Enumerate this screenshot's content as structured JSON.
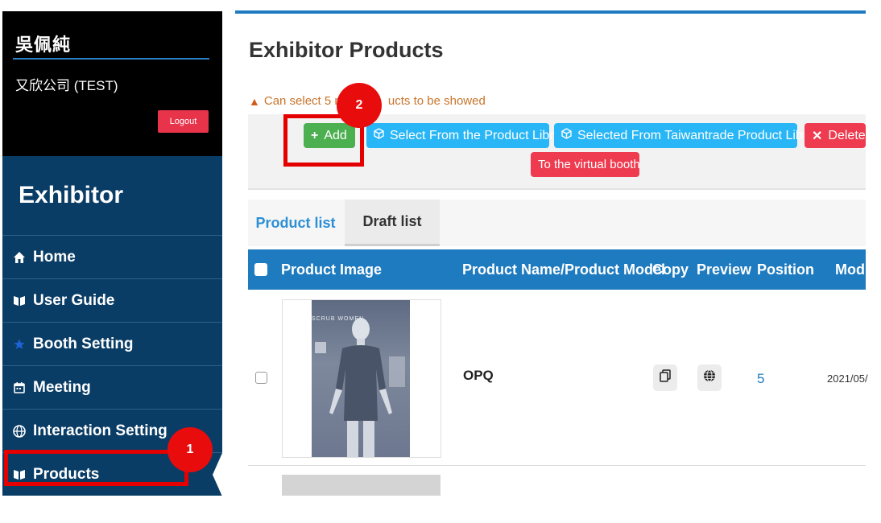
{
  "user": {
    "name": "吳佩純",
    "company": "又欣公司 (TEST)",
    "logout_label": "Logout"
  },
  "sidebar": {
    "section_title": "Exhibitor",
    "items": [
      {
        "label": "Home",
        "icon": "home-icon"
      },
      {
        "label": "User Guide",
        "icon": "book-icon"
      },
      {
        "label": "Booth Setting",
        "icon": "star-icon"
      },
      {
        "label": "Meeting",
        "icon": "calendar-icon"
      },
      {
        "label": "Interaction Setting",
        "icon": "globe-icon"
      },
      {
        "label": "Products",
        "icon": "book-icon",
        "active": true
      }
    ]
  },
  "main": {
    "title": "Exhibitor Products",
    "notice_prefix": "Can select 5 m",
    "notice_suffix": "ucts to be showed",
    "toolbar": {
      "add": "Add",
      "select_library": "Select From the Product Library",
      "select_taiwantrade": "Selected From Taiwantrade Product Library",
      "delete": "Delete",
      "virtual_booth": "To the virtual booth"
    },
    "tabs": [
      "Product list",
      "Draft list"
    ],
    "columns": {
      "image": "Product Image",
      "name": "Product Name/Product Model",
      "copy": "Copy",
      "preview": "Preview",
      "position": "Position",
      "modified": "Modif"
    },
    "rows": [
      {
        "name": "OPQ",
        "position": "5",
        "modified": "2021/05/",
        "image_text": "SCRUB WOMEN"
      }
    ]
  },
  "annotations": {
    "step1": "1",
    "step2": "2"
  },
  "colors": {
    "accent": "#1f7bbf",
    "sidebar": "#0a3d66",
    "add": "#4caf50",
    "library": "#29b6f6",
    "danger": "#ef3b4f",
    "highlight": "#e50000"
  }
}
